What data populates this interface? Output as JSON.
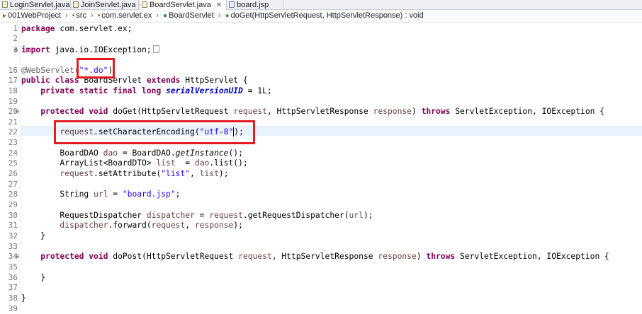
{
  "tabs": [
    {
      "label": "LoginServlet.java",
      "active": false,
      "icon": "java-file-icon"
    },
    {
      "label": "JoinServlet.java",
      "active": false,
      "icon": "java-file-icon"
    },
    {
      "label": "BoardServlet.java",
      "active": true,
      "icon": "java-file-icon",
      "close": "✕"
    },
    {
      "label": "board.jsp",
      "active": false,
      "icon": "jsp-file-icon"
    }
  ],
  "breadcrumb": {
    "project": "001WebProject",
    "folder": "src",
    "package": "com.servlet.ex",
    "class": "BoardServlet",
    "method": "doGet(HttpServletRequest, HttpServletResponse) : void"
  },
  "line_numbers": [
    "1",
    "2",
    "3",
    "16",
    "17",
    "18",
    "19",
    "20",
    "21",
    "22",
    "23",
    "24",
    "25",
    "26",
    "27",
    "28",
    "29",
    "30",
    "31",
    "32",
    "33",
    "34",
    "35",
    "36",
    "37",
    "38",
    "39"
  ],
  "code": {
    "pkg_kw": "package",
    "pkg_name": " com.servlet.ex;",
    "import_kw": "import",
    "import_name": " java.io.IOException;",
    "annotation": "@WebServlet(",
    "annotation_value": "\"*.do\"",
    "annotation_close": ")",
    "class_line_kw1": "public",
    "class_line_kw2": "class",
    "class_name": " BoardServlet ",
    "extends_kw": "extends",
    "class_parent": " HttpServlet {",
    "field_mods": "private static final long",
    "field_name": "serialVersionUID",
    "field_value": " = 1L;",
    "doget_kw1": "protected",
    "doget_kw2": "void",
    "doget_sig_a": " doGet(HttpServletRequest ",
    "doget_p1": "request",
    "doget_sig_b": ", HttpServletResponse ",
    "doget_p2": "response",
    "doget_sig_c": ") ",
    "throws_kw": "throws",
    "doget_sig_d": " ServletException, IOException {",
    "enc_var": "request",
    "enc_call": ".setCharacterEncoding(",
    "enc_arg": "\"utf-8\"",
    "enc_close": ");",
    "dao_type": "BoardDAO ",
    "dao_var": "dao",
    "dao_eq": " = BoardDAO.",
    "dao_call": "getInstance",
    "dao_end": "();",
    "list_type": "ArrayList<BoardDTO> ",
    "list_var": "list",
    "list_eq": "  = ",
    "list_dao": "dao",
    "list_end": ".list();",
    "attr_var": "request",
    "attr_call": ".setAttribute(",
    "attr_str": "\"list\"",
    "attr_mid": ", ",
    "attr_list": "list",
    "attr_end": ");",
    "url_type": "String ",
    "url_var": "url",
    "url_eq": " = ",
    "url_str": "\"board.jsp\"",
    "url_end": ";",
    "rd_type": "RequestDispatcher ",
    "rd_var": "dispatcher",
    "rd_eq": " = ",
    "rd_req": "request",
    "rd_call": ".getRequestDispatcher(",
    "rd_url": "url",
    "rd_end": ");",
    "fwd_var": "dispatcher",
    "fwd_call": ".forward(",
    "fwd_req": "request",
    "fwd_mid": ", ",
    "fwd_resp": "response",
    "fwd_end": ");",
    "close_brace": "}",
    "dopost_kw1": "protected",
    "dopost_kw2": "void",
    "dopost_sig_a": " doPost(HttpServletRequest ",
    "dopost_p1": "request",
    "dopost_sig_b": ", HttpServletResponse ",
    "dopost_p2": "response",
    "dopost_sig_c": ") ",
    "dopost_throws": "throws",
    "dopost_sig_d": " ServletException, IOException {"
  },
  "colors": {
    "keyword": "#7f0055",
    "string": "#2a00ff",
    "annotation": "#646464",
    "local_var": "#6a3e3e",
    "field": "#0000c0",
    "current_line": "#e8f2fe",
    "highlight_box": "#e31b23"
  }
}
